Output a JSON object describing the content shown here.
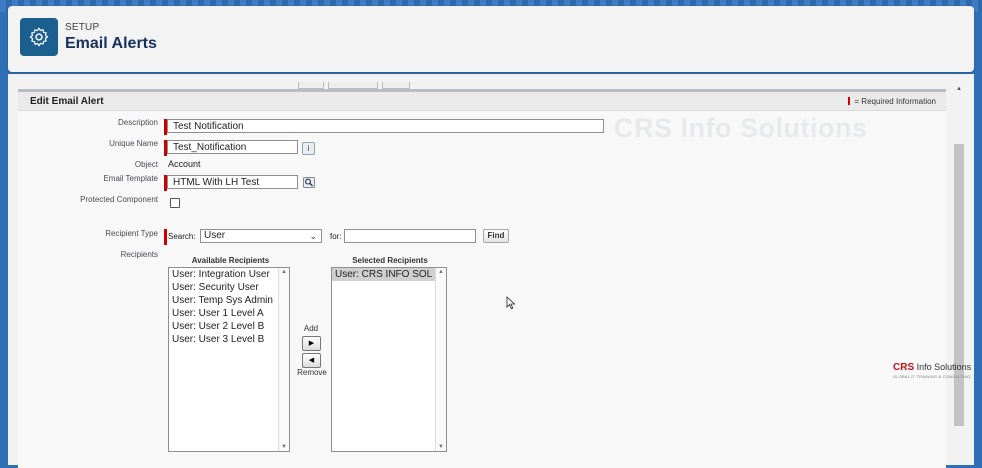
{
  "header": {
    "section": "SETUP",
    "title": "Email Alerts",
    "icon": "gear-icon"
  },
  "panel": {
    "title": "Edit Email Alert",
    "required_info": "= Required Information",
    "required_color": "#cc0000"
  },
  "form": {
    "description": {
      "label": "Description",
      "value": "Test Notification"
    },
    "unique_name": {
      "label": "Unique Name",
      "value": "Test_Notification",
      "info_icon": "info-icon"
    },
    "object": {
      "label": "Object",
      "value": "Account"
    },
    "email_template": {
      "label": "Email Template",
      "value": "HTML With LH Test",
      "lookup_icon": "lookup-icon"
    },
    "protected_component": {
      "label": "Protected Component",
      "checked": false
    },
    "recipient_type": {
      "label": "Recipient Type",
      "search_label": "Search:",
      "search_value": "User",
      "for_label": "for:",
      "for_value": "",
      "find_button": "Find"
    },
    "recipients": {
      "label": "Recipients",
      "available_header": "Available Recipients",
      "available": [
        "User: Integration User",
        "User: Security User",
        "User: Temp Sys Admin",
        "User: User 1 Level A",
        "User: User 2 Level B",
        "User: User 3 Level B"
      ],
      "add_label": "Add",
      "remove_label": "Remove",
      "selected_header": "Selected Recipients",
      "selected": [
        "User: CRS INFO SOL"
      ]
    }
  },
  "watermark": "CRS Info Solutions",
  "logo": {
    "brand": "CRS",
    "text": "Info Solutions",
    "tagline": "GLOBAL IT TRAINING & CONSULTING"
  }
}
